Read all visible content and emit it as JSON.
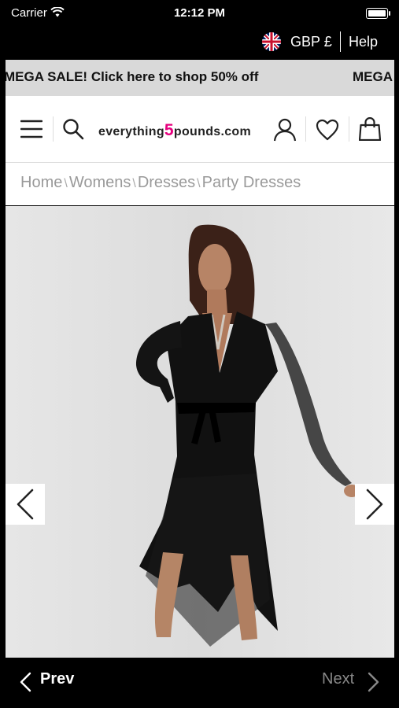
{
  "status_bar": {
    "carrier": "Carrier",
    "time": "12:12 PM"
  },
  "top_bar": {
    "currency": "GBP £",
    "help": "Help"
  },
  "promo": {
    "text": "MEGA SALE! Click here to shop 50% off",
    "text_repeat": "MEGA"
  },
  "header": {
    "logo_before": "everything",
    "logo_number": "5",
    "logo_after": "pounds.com",
    "icons": [
      "menu-icon",
      "search-icon",
      "account-icon",
      "wishlist-icon",
      "bag-icon"
    ]
  },
  "breadcrumb": {
    "items": [
      "Home",
      "Womens",
      "Dresses",
      "Party Dresses"
    ],
    "separator": "\\"
  },
  "product": {
    "image": "model in black chiffon wrap dress",
    "background": "#e3e3e3"
  },
  "pager": {
    "prev": "Prev",
    "next": "Next"
  },
  "colors": {
    "brand": "#e6007e",
    "promo_bg": "#d9d9d9"
  }
}
